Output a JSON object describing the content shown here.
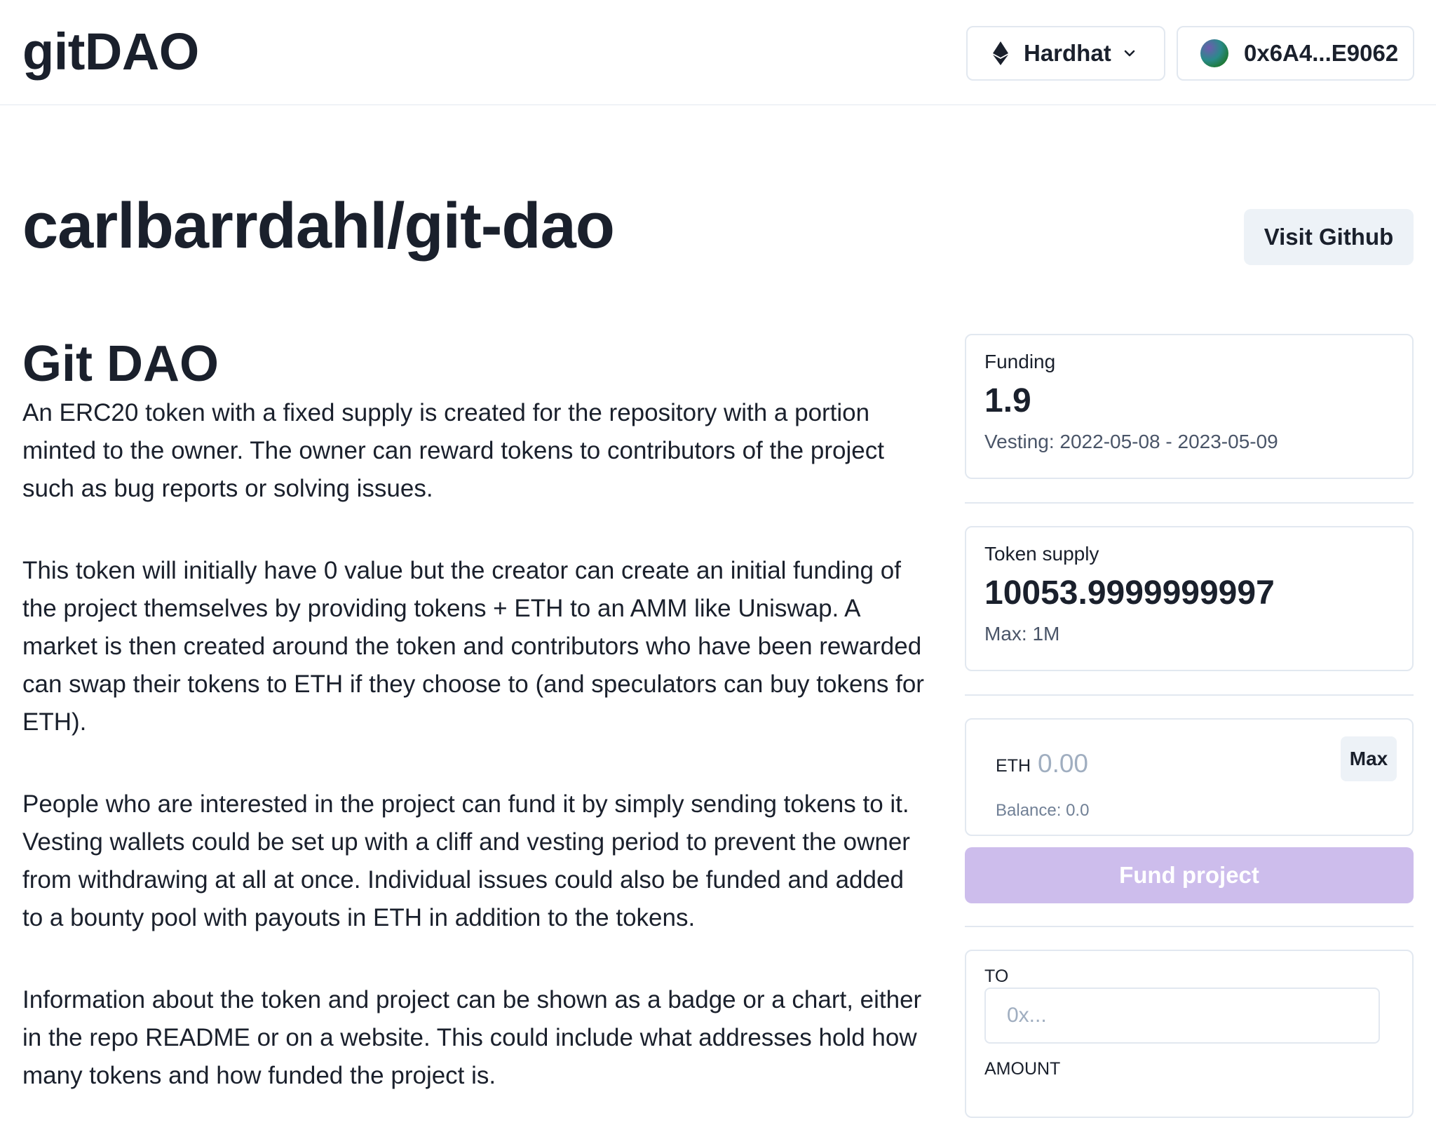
{
  "header": {
    "logo": "gitDAO",
    "network": {
      "label": "Hardhat",
      "icon": "ethereum-icon"
    },
    "account": {
      "address": "0x6A4...E9062"
    }
  },
  "repo": {
    "title": "carlbarrdahl/git-dao",
    "visit_label": "Visit Github"
  },
  "project": {
    "title": "Git DAO",
    "paragraphs": [
      "An ERC20 token with a fixed supply is created for the repository with a portion minted to the owner. The owner can reward tokens to contributors of the project such as bug reports or solving issues.",
      "This token will initially have 0 value but the creator can create an initial funding of the project themselves by providing tokens + ETH to an AMM like Uniswap. A market is then created around the token and contributors who have been rewarded can swap their tokens to ETH if they choose to (and speculators can buy tokens for ETH).",
      "People who are interested in the project can fund it by simply sending tokens to it. Vesting wallets could be set up with a cliff and vesting period to prevent the owner from withdrawing at all at once. Individual issues could also be funded and added to a bounty pool with payouts in ETH in addition to the tokens.",
      "Information about the token and project can be shown as a badge or a chart, either in the repo README or on a website. This could include what addresses hold how many tokens and how funded the project is."
    ]
  },
  "stats": {
    "funding": {
      "label": "Funding",
      "value": "1.9",
      "help": "Vesting: 2022-05-08 - 2023-05-09"
    },
    "supply": {
      "label": "Token supply",
      "value": "10053.9999999997",
      "help": "Max: 1M"
    }
  },
  "fund": {
    "currency": "ETH",
    "placeholder": "0.00",
    "max_label": "Max",
    "balance": "Balance: 0.0",
    "button_label": "Fund project"
  },
  "transfer": {
    "to_label": "TO",
    "to_placeholder": "0x...",
    "amount_label": "AMOUNT"
  },
  "colors": {
    "text": "#1a202c",
    "border": "#e2e8f0",
    "button_bg": "#edf2f7",
    "fund_button_disabled": "#cdbdec"
  }
}
